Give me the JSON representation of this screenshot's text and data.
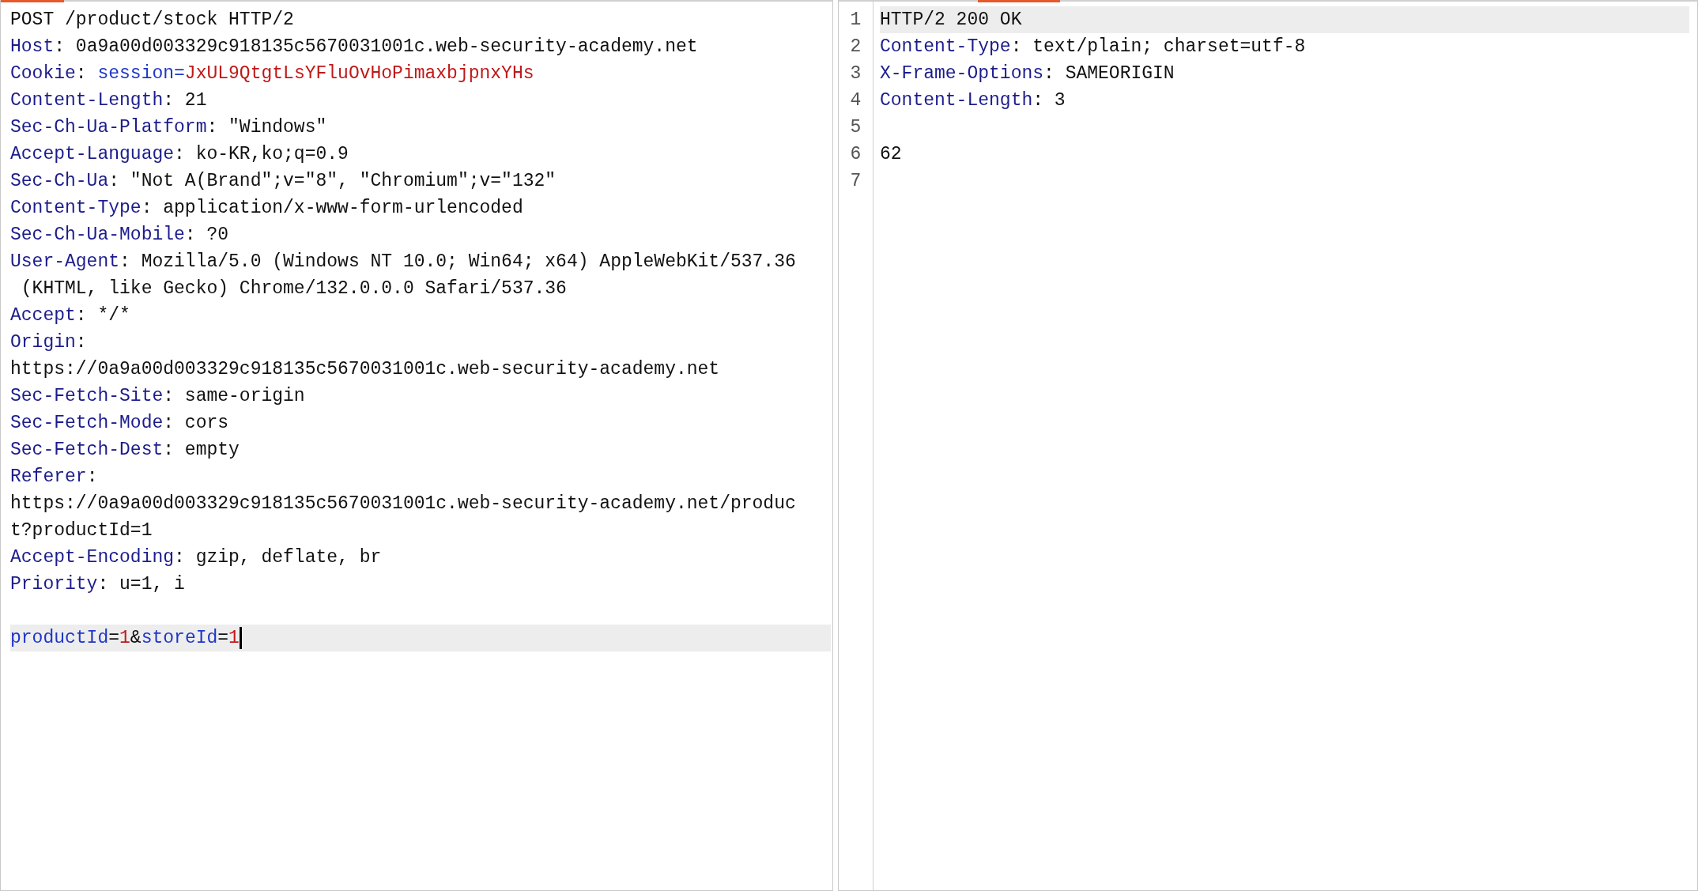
{
  "request": {
    "lines": [
      {
        "current": false,
        "segments": [
          {
            "kind": "text",
            "text": "POST /product/stock HTTP/2"
          }
        ]
      },
      {
        "current": false,
        "segments": [
          {
            "kind": "name",
            "text": "Host"
          },
          {
            "kind": "text",
            "text": ": 0a9a00d003329c918135c5670031001c.web-security-academy.net"
          }
        ]
      },
      {
        "current": false,
        "segments": [
          {
            "kind": "name",
            "text": "Cookie"
          },
          {
            "kind": "text",
            "text": ": "
          },
          {
            "kind": "param",
            "text": "session="
          },
          {
            "kind": "value",
            "text": "JxUL9QtgtLsYFluOvHoPimaxbjpnxYHs"
          }
        ]
      },
      {
        "current": false,
        "segments": [
          {
            "kind": "name",
            "text": "Content-Length"
          },
          {
            "kind": "text",
            "text": ": 21"
          }
        ]
      },
      {
        "current": false,
        "segments": [
          {
            "kind": "name",
            "text": "Sec-Ch-Ua-Platform"
          },
          {
            "kind": "text",
            "text": ": \"Windows\""
          }
        ]
      },
      {
        "current": false,
        "segments": [
          {
            "kind": "name",
            "text": "Accept-Language"
          },
          {
            "kind": "text",
            "text": ": ko-KR,ko;q=0.9"
          }
        ]
      },
      {
        "current": false,
        "segments": [
          {
            "kind": "name",
            "text": "Sec-Ch-Ua"
          },
          {
            "kind": "text",
            "text": ": \"Not A(Brand\";v=\"8\", \"Chromium\";v=\"132\""
          }
        ]
      },
      {
        "current": false,
        "segments": [
          {
            "kind": "name",
            "text": "Content-Type"
          },
          {
            "kind": "text",
            "text": ": application/x-www-form-urlencoded"
          }
        ]
      },
      {
        "current": false,
        "segments": [
          {
            "kind": "name",
            "text": "Sec-Ch-Ua-Mobile"
          },
          {
            "kind": "text",
            "text": ": ?0"
          }
        ]
      },
      {
        "current": false,
        "segments": [
          {
            "kind": "name",
            "text": "User-Agent"
          },
          {
            "kind": "text",
            "text": ": Mozilla/5.0 (Windows NT 10.0; Win64; x64) AppleWebKit/537.36"
          }
        ]
      },
      {
        "current": false,
        "segments": [
          {
            "kind": "text",
            "text": " (KHTML, like Gecko) Chrome/132.0.0.0 Safari/537.36"
          }
        ]
      },
      {
        "current": false,
        "segments": [
          {
            "kind": "name",
            "text": "Accept"
          },
          {
            "kind": "text",
            "text": ": */*"
          }
        ]
      },
      {
        "current": false,
        "segments": [
          {
            "kind": "name",
            "text": "Origin"
          },
          {
            "kind": "text",
            "text": ":"
          }
        ]
      },
      {
        "current": false,
        "segments": [
          {
            "kind": "text",
            "text": "https://0a9a00d003329c918135c5670031001c.web-security-academy.net"
          }
        ]
      },
      {
        "current": false,
        "segments": [
          {
            "kind": "name",
            "text": "Sec-Fetch-Site"
          },
          {
            "kind": "text",
            "text": ": same-origin"
          }
        ]
      },
      {
        "current": false,
        "segments": [
          {
            "kind": "name",
            "text": "Sec-Fetch-Mode"
          },
          {
            "kind": "text",
            "text": ": cors"
          }
        ]
      },
      {
        "current": false,
        "segments": [
          {
            "kind": "name",
            "text": "Sec-Fetch-Dest"
          },
          {
            "kind": "text",
            "text": ": empty"
          }
        ]
      },
      {
        "current": false,
        "segments": [
          {
            "kind": "name",
            "text": "Referer"
          },
          {
            "kind": "text",
            "text": ":"
          }
        ]
      },
      {
        "current": false,
        "segments": [
          {
            "kind": "text",
            "text": "https://0a9a00d003329c918135c5670031001c.web-security-academy.net/produc"
          }
        ]
      },
      {
        "current": false,
        "segments": [
          {
            "kind": "text",
            "text": "t?productId=1"
          }
        ]
      },
      {
        "current": false,
        "segments": [
          {
            "kind": "name",
            "text": "Accept-Encoding"
          },
          {
            "kind": "text",
            "text": ": gzip, deflate, br"
          }
        ]
      },
      {
        "current": false,
        "segments": [
          {
            "kind": "name",
            "text": "Priority"
          },
          {
            "kind": "text",
            "text": ": u=1, i"
          }
        ]
      }
    ],
    "body": {
      "current": true,
      "segments": [
        {
          "kind": "param",
          "text": "productId"
        },
        {
          "kind": "text",
          "text": "="
        },
        {
          "kind": "value",
          "text": "1"
        },
        {
          "kind": "text",
          "text": "&"
        },
        {
          "kind": "param",
          "text": "storeId"
        },
        {
          "kind": "text",
          "text": "="
        },
        {
          "kind": "value",
          "text": "1"
        }
      ]
    }
  },
  "response": {
    "lines": [
      {
        "number": "1",
        "current": true,
        "segments": [
          {
            "kind": "text",
            "text": "HTTP/2 200 OK"
          }
        ]
      },
      {
        "number": "2",
        "current": false,
        "segments": [
          {
            "kind": "name",
            "text": "Content-Type"
          },
          {
            "kind": "text",
            "text": ": text/plain; charset=utf-8"
          }
        ]
      },
      {
        "number": "3",
        "current": false,
        "segments": [
          {
            "kind": "name",
            "text": "X-Frame-Options"
          },
          {
            "kind": "text",
            "text": ": SAMEORIGIN"
          }
        ]
      },
      {
        "number": "4",
        "current": false,
        "segments": [
          {
            "kind": "name",
            "text": "Content-Length"
          },
          {
            "kind": "text",
            "text": ": 3"
          }
        ]
      },
      {
        "number": "5"
      },
      {
        "number": "6",
        "current": false,
        "segments": [
          {
            "kind": "text",
            "text": "62"
          }
        ]
      },
      {
        "number": "7"
      }
    ]
  }
}
